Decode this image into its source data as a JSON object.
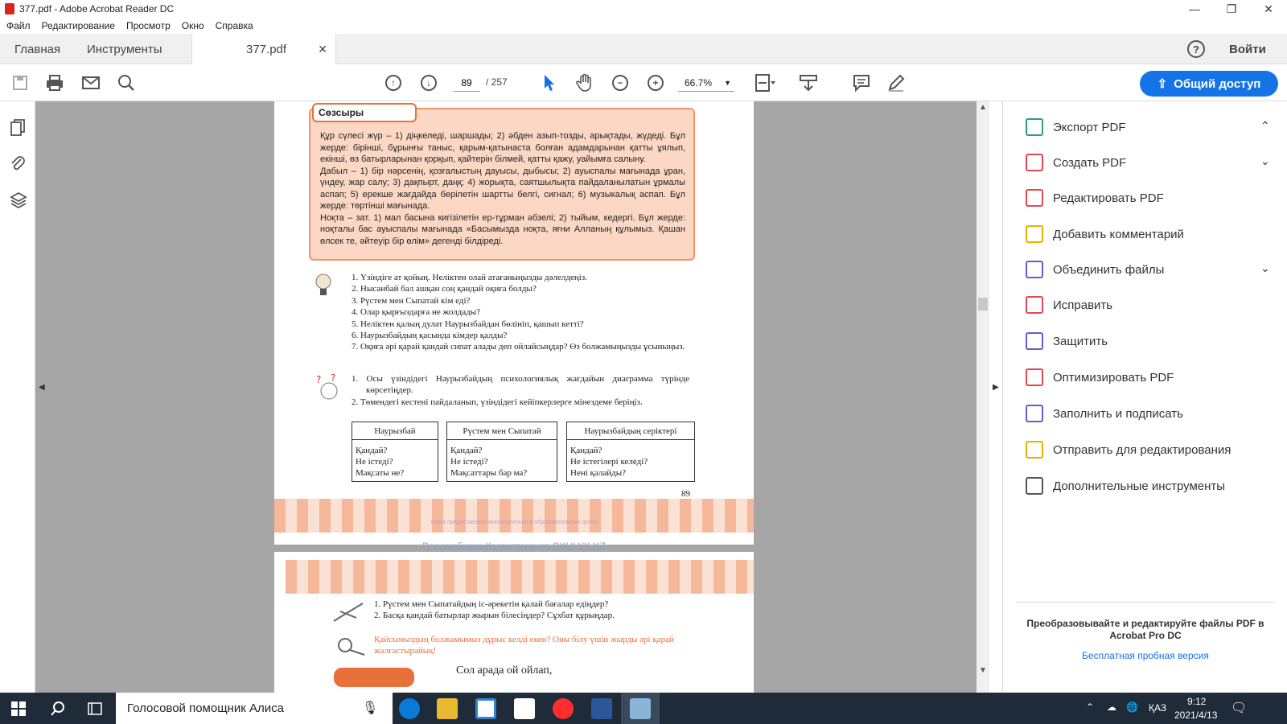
{
  "window": {
    "title": "377.pdf - Adobe Acrobat Reader DC",
    "controls": {
      "minimize": "—",
      "restore": "❐",
      "close": "✕"
    }
  },
  "menu": [
    "Файл",
    "Редактирование",
    "Просмотр",
    "Окно",
    "Справка"
  ],
  "tabs": {
    "home": "Главная",
    "tools": "Инструменты",
    "document": "377.pdf",
    "close": "✕",
    "help": "?",
    "signin": "Войти"
  },
  "toolbar": {
    "page_current": "89",
    "page_total": "/  257",
    "zoom": "66.7%",
    "share_label": "Общий доступ"
  },
  "page1": {
    "gloss_title": "Сөзсыры",
    "gloss_text": [
      "Құр сүлесі жүр – 1) діңкеледі, шаршады; 2) әбден азып-тозды, арықтады, жүдеді. Бұл жерде: бірінші, бұрынғы таныс, қарым-қатынаста болған адамдарынан қатты ұялып, екінші, өз батырларынан қорқып, қайтерін білмей, қатты қажу, уайымға салыну.",
      "Дабыл – 1) бір нәрсенің, қозғалыстың дауысы, дыбысы; 2) ауыспалы мағынада ұран, үндеу, жар салу; 3) дақпырт, даңқ; 4) жорықта, саятшылықта пайдаланылатын ұрмалы аспап; 5) ерекше жағдайда берілетін шартты белгі, сигнал; 6) музыкалық аспап. Бұл жерде: төртінші мағынада.",
      "Ноқта – зат. 1) мал басына кигізілетін ер-тұрман әбзелі; 2) тыйым, кедергі. Бұл жерде: ноқталы бас ауыспалы мағынада «Басымызда ноқта, яғни Алланың құлымыз. Қашан өлсек те, әйтеуір бір өлім» дегенді білдіреді."
    ],
    "questions": [
      "1.  Үзіндіге ат қойың. Неліктен олай атағаныңызды дәлелдеңіз.",
      "2.  Нысанбай бал ашқан соң қандай оқиға болды?",
      "3.  Рүстем мен Сыпатай кім еді?",
      "4.  Олар қырғыздарға не жолдады?",
      "5.  Неліктен қалың дулат Наурызбайдан бөлініп, қашып кетті?",
      "6.  Наурызбайдың қасында кімдер қалды?",
      "7.  Оқиға әрі қарай қандай сипат алады деп ойлайсыңдар? Өз болжамыңызды ұсыныңыз."
    ],
    "tasks": [
      "1.  Осы үзіндідегі Наурызбайдың психологиялық жағдайын диаграмма түрінде көрсетіңдер.",
      "2.  Төмендегі кестені пайдаланып, үзіндідегі кейіпкерлерге мінездеме беріңіз."
    ],
    "table": [
      {
        "header": "Наурызбай",
        "rows": [
          "Қандай?",
          "Не істеді?",
          "Мақсаты не?"
        ]
      },
      {
        "header": "Рүстем мен Сыпатай",
        "rows": [
          "Қандай?",
          "Не істеді?",
          "Мақсаттары бар ма?"
        ]
      },
      {
        "header": "Наурызбайдың серіктері",
        "rows": [
          "Қандай?",
          "Не істегілері келеді?",
          "Нені қалайды?"
        ]
      }
    ],
    "page_number": "89",
    "footer_note": "Книга предоставлена исключительно в образовательных целях"
  },
  "watermark": "Все учебники Казахстана на OKULYK.KZ",
  "page2": {
    "lines": [
      "1.  Рүстем мен Сыпатайдың іс-әрекетін қалай бағалар едіңдер?",
      "2.  Басқа қандай батырлар жырын білесіңдер? Сұхбат құрыңдар."
    ],
    "orange_text": "Қайсымыздың болжамымыз дұрыс келді екен? Оны білу үшін жырды әрі қарай жалғастырайық!",
    "poem_line": "Сол арада ой ойлап,"
  },
  "right_panel": {
    "items": [
      {
        "label": "Экспорт PDF",
        "color": "#2d9d78",
        "chevron": "^"
      },
      {
        "label": "Создать PDF",
        "color": "#e34850",
        "chevron": "v"
      },
      {
        "label": "Редактировать PDF",
        "color": "#e34850",
        "chevron": ""
      },
      {
        "label": "Добавить комментарий",
        "color": "#e8b100",
        "chevron": ""
      },
      {
        "label": "Объединить файлы",
        "color": "#6e57d6",
        "chevron": "v"
      },
      {
        "label": "Исправить",
        "color": "#e34850",
        "chevron": ""
      },
      {
        "label": "Защитить",
        "color": "#6e57d6",
        "chevron": ""
      },
      {
        "label": "Оптимизировать PDF",
        "color": "#e34850",
        "chevron": ""
      },
      {
        "label": "Заполнить и подписать",
        "color": "#6e57d6",
        "chevron": ""
      },
      {
        "label": "Отправить для редактирования",
        "color": "#e8b100",
        "chevron": ""
      },
      {
        "label": "Дополнительные инструменты",
        "color": "#555555",
        "chevron": ""
      }
    ],
    "promo_text": "Преобразовывайте и редактируйте файлы PDF в Acrobat Pro DC",
    "trial_link": "Бесплатная пробная версия"
  },
  "taskbar": {
    "search_text": "Голосовой помощник Алиса",
    "lang": "ҚАЗ",
    "time": "9:12",
    "date": "2021/4/13"
  },
  "colors": {
    "accent": "#1473e6",
    "taskbar": "#1f2b38",
    "gloss_bg": "#fcd8c4"
  }
}
